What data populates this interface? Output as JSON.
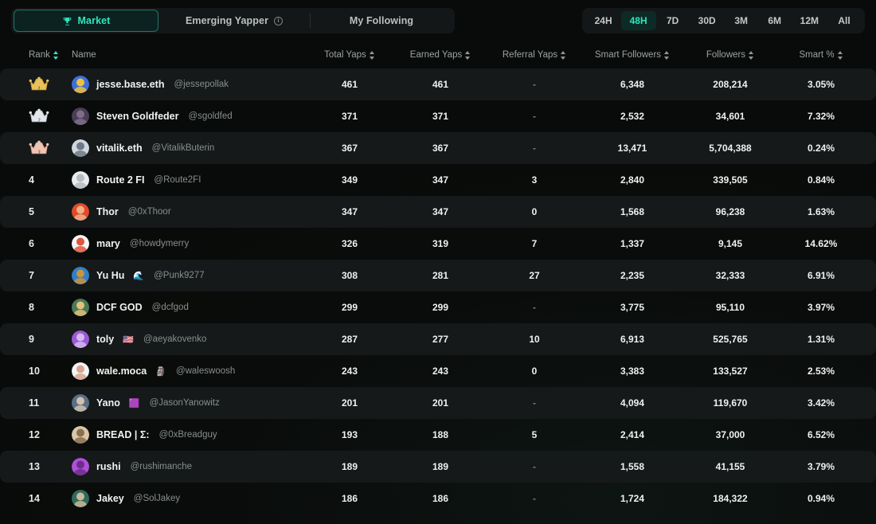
{
  "tabs": [
    {
      "label": "Market",
      "icon": "trophy-icon",
      "active": true
    },
    {
      "label": "Emerging Yapper",
      "icon": "info-icon",
      "active": false
    },
    {
      "label": "My Following",
      "icon": "",
      "active": false
    }
  ],
  "periods": [
    {
      "label": "24H",
      "active": false
    },
    {
      "label": "48H",
      "active": true
    },
    {
      "label": "7D",
      "active": false
    },
    {
      "label": "30D",
      "active": false
    },
    {
      "label": "3M",
      "active": false
    },
    {
      "label": "6M",
      "active": false
    },
    {
      "label": "12M",
      "active": false
    },
    {
      "label": "All",
      "active": false
    }
  ],
  "columns": {
    "rank": "Rank",
    "name": "Name",
    "total_yaps": "Total Yaps",
    "earned_yaps": "Earned Yaps",
    "referral_yaps": "Referral Yaps",
    "smart_followers": "Smart Followers",
    "followers": "Followers",
    "smart_pct": "Smart %"
  },
  "colors": {
    "accent": "#2ee6bd",
    "page_bg": "#0a0d0c",
    "row_alt": "#15191a",
    "gold": "#e8c15a",
    "silver": "#d6dade",
    "bronze": "#e8b9a6"
  },
  "rows": [
    {
      "rank": "1",
      "medal": "gold",
      "name": "jesse.base.eth",
      "emoji": "",
      "handle": "@jessepollak",
      "total": "461",
      "earned": "461",
      "referral": "-",
      "smart_followers": "6,348",
      "followers": "208,214",
      "smart_pct": "3.05%",
      "av1": "#3f6fd8",
      "av2": "#f0c23a"
    },
    {
      "rank": "2",
      "medal": "silver",
      "name": "Steven Goldfeder",
      "emoji": "",
      "handle": "@sgoldfed",
      "total": "371",
      "earned": "371",
      "referral": "-",
      "smart_followers": "2,532",
      "followers": "34,601",
      "smart_pct": "7.32%",
      "av1": "#4a3d56",
      "av2": "#7f6f86"
    },
    {
      "rank": "3",
      "medal": "bronze",
      "name": "vitalik.eth",
      "emoji": "",
      "handle": "@VitalikButerin",
      "total": "367",
      "earned": "367",
      "referral": "-",
      "smart_followers": "13,471",
      "followers": "5,704,388",
      "smart_pct": "0.24%",
      "av1": "#cfd6dd",
      "av2": "#6d7a86"
    },
    {
      "rank": "4",
      "medal": "",
      "name": "Route 2 FI",
      "emoji": "",
      "handle": "@Route2FI",
      "total": "349",
      "earned": "347",
      "referral": "3",
      "smart_followers": "2,840",
      "followers": "339,505",
      "smart_pct": "0.84%",
      "av1": "#e9ecef",
      "av2": "#b6bcc2"
    },
    {
      "rank": "5",
      "medal": "",
      "name": "Thor",
      "emoji": "",
      "handle": "@0xThoor",
      "total": "347",
      "earned": "347",
      "referral": "0",
      "smart_followers": "1,568",
      "followers": "96,238",
      "smart_pct": "1.63%",
      "av1": "#e24a2a",
      "av2": "#f0b08a"
    },
    {
      "rank": "6",
      "medal": "",
      "name": "mary",
      "emoji": "",
      "handle": "@howdymerry",
      "total": "326",
      "earned": "319",
      "referral": "7",
      "smart_followers": "1,337",
      "followers": "9,145",
      "smart_pct": "14.62%",
      "av1": "#f4f6f7",
      "av2": "#e0563c"
    },
    {
      "rank": "7",
      "medal": "",
      "name": "Yu Hu",
      "emoji": "🌊",
      "handle": "@Punk9277",
      "total": "308",
      "earned": "281",
      "referral": "27",
      "smart_followers": "2,235",
      "followers": "32,333",
      "smart_pct": "6.91%",
      "av1": "#2f80c8",
      "av2": "#c9933f"
    },
    {
      "rank": "8",
      "medal": "",
      "name": "DCF GOD",
      "emoji": "",
      "handle": "@dcfgod",
      "total": "299",
      "earned": "299",
      "referral": "-",
      "smart_followers": "3,775",
      "followers": "95,110",
      "smart_pct": "3.97%",
      "av1": "#4a7a56",
      "av2": "#e4c07a"
    },
    {
      "rank": "9",
      "medal": "",
      "name": "toly",
      "emoji": "🇺🇸",
      "handle": "@aeyakovenko",
      "total": "287",
      "earned": "277",
      "referral": "10",
      "smart_followers": "6,913",
      "followers": "525,765",
      "smart_pct": "1.31%",
      "av1": "#9b5ad6",
      "av2": "#d7b7f0"
    },
    {
      "rank": "10",
      "medal": "",
      "name": "wale.moca",
      "emoji": "🗿",
      "handle": "@waleswoosh",
      "total": "243",
      "earned": "243",
      "referral": "0",
      "smart_followers": "3,383",
      "followers": "133,527",
      "smart_pct": "2.53%",
      "av1": "#f2f4f5",
      "av2": "#d8a58e"
    },
    {
      "rank": "11",
      "medal": "",
      "name": "Yano",
      "emoji": "🟪",
      "handle": "@JasonYanowitz",
      "total": "201",
      "earned": "201",
      "referral": "-",
      "smart_followers": "4,094",
      "followers": "119,670",
      "smart_pct": "3.42%",
      "av1": "#5a6e84",
      "av2": "#d0c0b0"
    },
    {
      "rank": "12",
      "medal": "",
      "name": "BREAD | Σ:",
      "emoji": "",
      "handle": "@0xBreadguy",
      "total": "193",
      "earned": "188",
      "referral": "5",
      "smart_followers": "2,414",
      "followers": "37,000",
      "smart_pct": "6.52%",
      "av1": "#d9c7a8",
      "av2": "#8a6f50"
    },
    {
      "rank": "13",
      "medal": "",
      "name": "rushi",
      "emoji": "",
      "handle": "@rushimanche",
      "total": "189",
      "earned": "189",
      "referral": "-",
      "smart_followers": "1,558",
      "followers": "41,155",
      "smart_pct": "3.79%",
      "av1": "#b14fd8",
      "av2": "#6a2f8a"
    },
    {
      "rank": "14",
      "medal": "",
      "name": "Jakey",
      "emoji": "",
      "handle": "@SolJakey",
      "total": "186",
      "earned": "186",
      "referral": "-",
      "smart_followers": "1,724",
      "followers": "184,322",
      "smart_pct": "0.94%",
      "av1": "#2f6b5a",
      "av2": "#cbb79a"
    }
  ]
}
